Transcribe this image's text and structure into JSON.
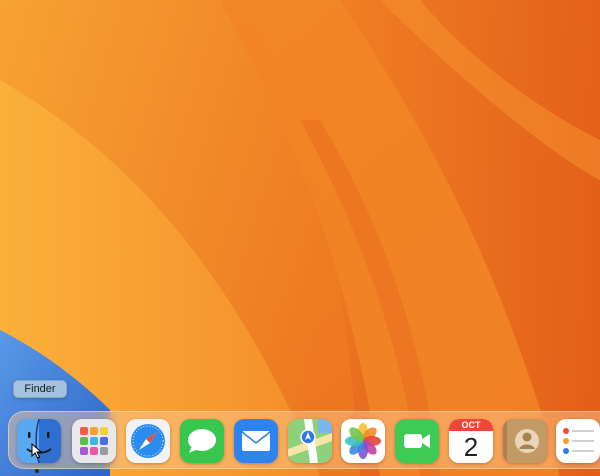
{
  "tooltip": {
    "label": "Finder"
  },
  "dock": {
    "items": [
      {
        "name": "finder",
        "icon": "finder-icon",
        "running": true
      },
      {
        "name": "launchpad",
        "icon": "launchpad-icon"
      },
      {
        "name": "safari",
        "icon": "safari-icon"
      },
      {
        "name": "messages",
        "icon": "messages-icon"
      },
      {
        "name": "mail",
        "icon": "mail-icon"
      },
      {
        "name": "maps",
        "icon": "maps-icon"
      },
      {
        "name": "photos",
        "icon": "photos-icon"
      },
      {
        "name": "facetime",
        "icon": "facetime-icon"
      },
      {
        "name": "calendar",
        "icon": "calendar-icon",
        "month": "OCT",
        "day": "2"
      },
      {
        "name": "contacts",
        "icon": "contacts-icon"
      },
      {
        "name": "reminders",
        "icon": "reminders-icon"
      }
    ]
  },
  "colors": {
    "wallpaper_light": "#f7b13c",
    "wallpaper_mid": "#f28a2a",
    "wallpaper_dark": "#e4601a",
    "accent_blue": "#3d7bd8"
  }
}
